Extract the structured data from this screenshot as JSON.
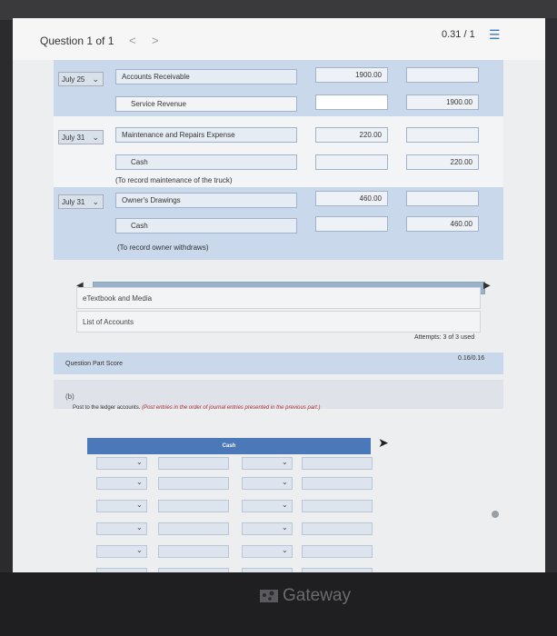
{
  "header": {
    "question": "Question 1 of 1",
    "prev": "<",
    "next": ">",
    "score": "0.31 / 1",
    "list_icon": "list-icon"
  },
  "journal": [
    {
      "date": "July 25",
      "debit_account": "Accounts Receivable",
      "debit_amount": "1900.00",
      "credit_account": "Service Revenue",
      "credit_amount": "1900.00",
      "note": ""
    },
    {
      "date": "July 31",
      "debit_account": "Maintenance and Repairs Expense",
      "debit_amount": "220.00",
      "credit_account": "Cash",
      "credit_amount": "220.00",
      "note": "(To record maintenance of the truck)"
    },
    {
      "date": "July 31",
      "debit_account": "Owner's Drawings",
      "debit_amount": "460.00",
      "credit_account": "Cash",
      "credit_amount": "460.00",
      "note": "(To record owner withdraws)"
    }
  ],
  "links": {
    "etextbook": "eTextbook and Media",
    "accounts": "List of Accounts"
  },
  "attempts": "Attempts: 3 of 3 used",
  "part_score": {
    "label": "Question Part Score",
    "value": "0.16/0.16"
  },
  "part_b": {
    "label": "(b)",
    "instruction_lead": "Post to the ledger accounts.",
    "instruction_hint": "(Post entries in the order of journal entries presented in the previous part.)",
    "ledger_title": "Cash"
  },
  "footer": {
    "brand": "Gateway"
  },
  "colors": {
    "accent": "#4a78b8",
    "panel_blue": "#c9d8ea"
  }
}
